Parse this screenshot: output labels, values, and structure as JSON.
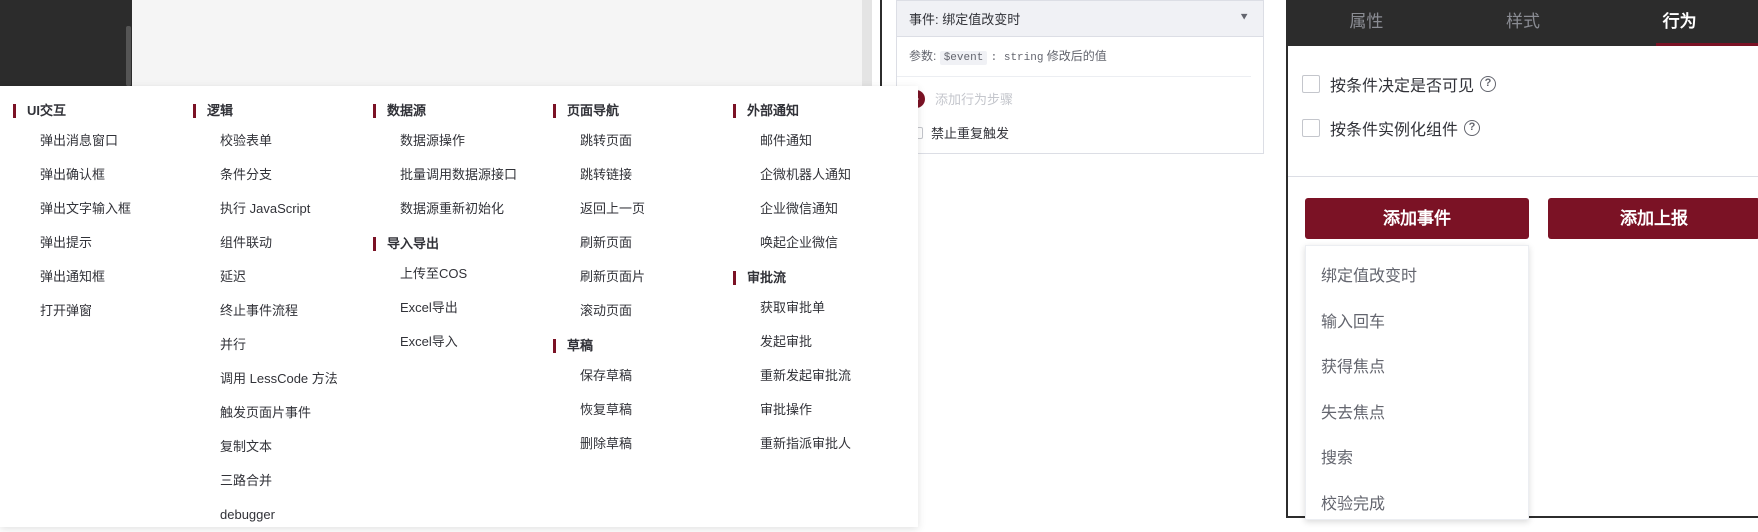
{
  "event_card": {
    "title": "事件: 绑定值改变时",
    "params_label": "参数:",
    "param_name": "$event",
    "param_type": ": string",
    "param_desc": "修改后的值",
    "add_step": "添加行为步骤",
    "no_repeat": "禁止重复触发"
  },
  "menu": {
    "columns": [
      {
        "groups": [
          {
            "title": "UI交互",
            "items": [
              "弹出消息窗口",
              "弹出确认框",
              "弹出文字输入框",
              "弹出提示",
              "弹出通知框",
              "打开弹窗"
            ]
          }
        ]
      },
      {
        "groups": [
          {
            "title": "逻辑",
            "items": [
              "校验表单",
              "条件分支",
              "执行 JavaScript",
              "组件联动",
              "延迟",
              "终止事件流程",
              "并行",
              "调用 LessCode 方法",
              "触发页面片事件",
              "复制文本",
              "三路合并",
              "debugger"
            ]
          }
        ]
      },
      {
        "groups": [
          {
            "title": "数据源",
            "items": [
              "数据源操作",
              "批量调用数据源接口",
              "数据源重新初始化"
            ]
          },
          {
            "title": "导入导出",
            "items": [
              "上传至COS",
              "Excel导出",
              "Excel导入"
            ]
          }
        ]
      },
      {
        "groups": [
          {
            "title": "页面导航",
            "items": [
              "跳转页面",
              "跳转链接",
              "返回上一页",
              "刷新页面",
              "刷新页面片",
              "滚动页面"
            ]
          },
          {
            "title": "草稿",
            "items": [
              "保存草稿",
              "恢复草稿",
              "删除草稿"
            ]
          }
        ]
      },
      {
        "groups": [
          {
            "title": "外部通知",
            "items": [
              "邮件通知",
              "企微机器人通知",
              "企业微信通知",
              "唤起企业微信"
            ]
          },
          {
            "title": "审批流",
            "items": [
              "获取审批单",
              "发起审批",
              "重新发起审批流",
              "审批操作",
              "重新指派审批人"
            ]
          }
        ]
      }
    ]
  },
  "panel": {
    "tabs": [
      "属性",
      "样式",
      "行为"
    ],
    "active_tab": "行为",
    "option_visible": "按条件决定是否可见",
    "option_instantiate": "按条件实例化组件",
    "help_glyph": "?",
    "add_event": "添加事件",
    "add_report": "添加上报",
    "events": [
      "绑定值改变时",
      "输入回车",
      "获得焦点",
      "失去焦点",
      "搜索",
      "校验完成"
    ]
  },
  "icons": {
    "collapse": "chevron-double-down-icon",
    "help": "question-circle-icon",
    "play": "play-circle-icon"
  },
  "colors": {
    "accent": "#7b1225",
    "dark": "#2c2c2c"
  }
}
